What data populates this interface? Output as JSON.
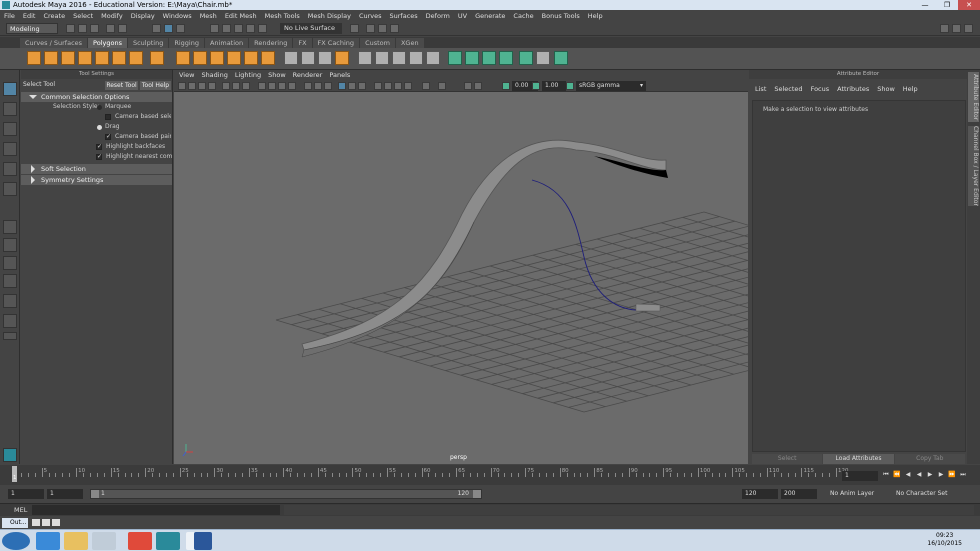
{
  "window": {
    "title": "Autodesk Maya 2016 - Educational Version: E:\\Maya\\Chair.mb*",
    "minimize": "—",
    "maximize": "❐",
    "close": "✕"
  },
  "menubar": [
    "File",
    "Edit",
    "Create",
    "Select",
    "Modify",
    "Display",
    "Windows",
    "Mesh",
    "Edit Mesh",
    "Mesh Tools",
    "Mesh Display",
    "Curves",
    "Surfaces",
    "Deform",
    "UV",
    "Generate",
    "Cache",
    "Bonus Tools",
    "Help"
  ],
  "status": {
    "mode": "Modeling",
    "live_surface": "No Live Surface"
  },
  "shelf_tabs": [
    "Curves / Surfaces",
    "Polygons",
    "Sculpting",
    "Rigging",
    "Animation",
    "Rendering",
    "FX",
    "FX Caching",
    "Custom",
    "XGen"
  ],
  "active_shelf_tab": "Polygons",
  "tool_settings": {
    "panel_title": "Tool Settings",
    "tool_name": "Select Tool",
    "reset_button": "Reset Tool",
    "help_button": "Tool Help",
    "section_common": "Common Selection Options",
    "selection_style_label": "Selection Style:",
    "marquee": "Marquee",
    "camera_based_selection": "Camera based selecti",
    "drag": "Drag",
    "camera_based_paint": "Camera based paint s",
    "highlight_backfaces": "Highlight backfaces",
    "highlight_nearest": "Highlight nearest compo",
    "section_soft": "Soft Selection",
    "section_symmetry": "Symmetry Settings"
  },
  "viewport": {
    "menu": [
      "View",
      "Shading",
      "Lighting",
      "Show",
      "Renderer",
      "Panels"
    ],
    "exposure": "0.00",
    "gamma": "1.00",
    "color_space": "sRGB gamma",
    "camera": "persp"
  },
  "attribute_editor": {
    "panel_title": "Attribute Editor",
    "menu": [
      "List",
      "Selected",
      "Focus",
      "Attributes",
      "Show",
      "Help"
    ],
    "message": "Make a selection to view attributes",
    "buttons": {
      "select": "Select",
      "load": "Load Attributes",
      "copy": "Copy Tab"
    }
  },
  "side_tabs": {
    "attribute_editor": "Attribute Editor",
    "channel_box": "Channel Box / Layer Editor"
  },
  "time_slider": {
    "ticks": [
      "5",
      "10",
      "15",
      "20",
      "25",
      "30",
      "35",
      "40",
      "45",
      "50",
      "55",
      "60",
      "65",
      "70",
      "75",
      "80",
      "85",
      "90",
      "95",
      "100",
      "105",
      "110",
      "115",
      "120"
    ],
    "current_frame_marker": "1",
    "current_frame": "1"
  },
  "range_slider": {
    "start": "1",
    "start_inner": "1",
    "range_start": "1",
    "range_end": "120",
    "end": "120",
    "end_total": "200",
    "anim_layer": "No Anim Layer",
    "character_set": "No Character Set"
  },
  "command_line": {
    "language": "MEL"
  },
  "help_line": {
    "tab_label": "Out..."
  },
  "taskbar": {
    "time": "09:23",
    "date": "16/10/2015"
  }
}
